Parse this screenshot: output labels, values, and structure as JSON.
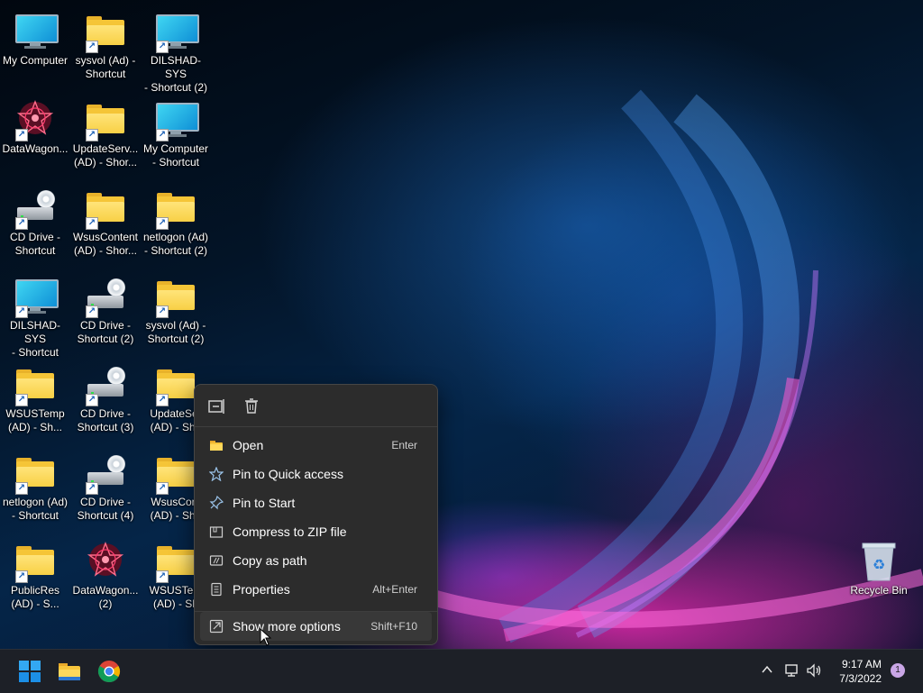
{
  "desktop": {
    "icons": [
      {
        "label": "My Computer",
        "type": "monitor",
        "shortcut": false
      },
      {
        "label": "sysvol (Ad) -\nShortcut",
        "type": "folder",
        "shortcut": true
      },
      {
        "label": "DILSHAD-SYS\n- Shortcut (2)",
        "type": "monitor",
        "shortcut": true
      },
      {
        "label": "DataWagon...",
        "type": "datawagon",
        "shortcut": true
      },
      {
        "label": "UpdateServ...\n(AD) - Shor...",
        "type": "folder",
        "shortcut": true
      },
      {
        "label": "My Computer\n- Shortcut",
        "type": "monitor",
        "shortcut": true
      },
      {
        "label": "CD Drive -\nShortcut",
        "type": "drive",
        "shortcut": true
      },
      {
        "label": "WsusContent\n(AD) - Shor...",
        "type": "folder",
        "shortcut": true
      },
      {
        "label": "netlogon (Ad)\n- Shortcut (2)",
        "type": "folder",
        "shortcut": true
      },
      {
        "label": "DILSHAD-SYS\n- Shortcut",
        "type": "monitor",
        "shortcut": true
      },
      {
        "label": "CD Drive -\nShortcut (2)",
        "type": "drive",
        "shortcut": true
      },
      {
        "label": "sysvol (Ad) -\nShortcut (2)",
        "type": "folder",
        "shortcut": true
      },
      {
        "label": "WSUSTemp\n(AD) - Sh...",
        "type": "folder",
        "shortcut": true
      },
      {
        "label": "CD Drive -\nShortcut (3)",
        "type": "drive",
        "shortcut": true
      },
      {
        "label": "UpdateSer\n(AD) - Sho",
        "type": "folder",
        "shortcut": true
      },
      {
        "label": "netlogon (Ad)\n- Shortcut",
        "type": "folder",
        "shortcut": true
      },
      {
        "label": "CD Drive -\nShortcut (4)",
        "type": "drive",
        "shortcut": true
      },
      {
        "label": "WsusCont\n(AD) - Sho",
        "type": "folder",
        "shortcut": true
      },
      {
        "label": "PublicRes\n(AD) - S...",
        "type": "folder",
        "shortcut": true
      },
      {
        "label": "DataWagon...\n(2)",
        "type": "datawagon",
        "shortcut": false
      },
      {
        "label": "WSUSTem\n(AD) - Sh",
        "type": "folder",
        "shortcut": true
      }
    ],
    "recycle_bin": {
      "label": "Recycle Bin"
    }
  },
  "context_menu": {
    "top_actions": [
      {
        "name": "rename",
        "icon": "rename-icon"
      },
      {
        "name": "delete",
        "icon": "trash-icon"
      }
    ],
    "items": [
      {
        "label": "Open",
        "shortcut": "Enter",
        "icon": "folder-icon"
      },
      {
        "label": "Pin to Quick access",
        "shortcut": "",
        "icon": "star-icon"
      },
      {
        "label": "Pin to Start",
        "shortcut": "",
        "icon": "pin-icon"
      },
      {
        "label": "Compress to ZIP file",
        "shortcut": "",
        "icon": "zip-icon"
      },
      {
        "label": "Copy as path",
        "shortcut": "",
        "icon": "path-icon"
      },
      {
        "label": "Properties",
        "shortcut": "Alt+Enter",
        "icon": "properties-icon"
      },
      {
        "label": "Show more options",
        "shortcut": "Shift+F10",
        "icon": "more-options-icon"
      }
    ]
  },
  "taskbar": {
    "apps": [
      "start-icon",
      "file-explorer-icon",
      "chrome-icon"
    ],
    "clock": {
      "time": "9:17 AM",
      "date": "7/3/2022"
    },
    "notifications": "1",
    "colors": {
      "accent": "#0078d4",
      "taskbar": "#1d2027",
      "menu": "#2c2c2c"
    }
  }
}
